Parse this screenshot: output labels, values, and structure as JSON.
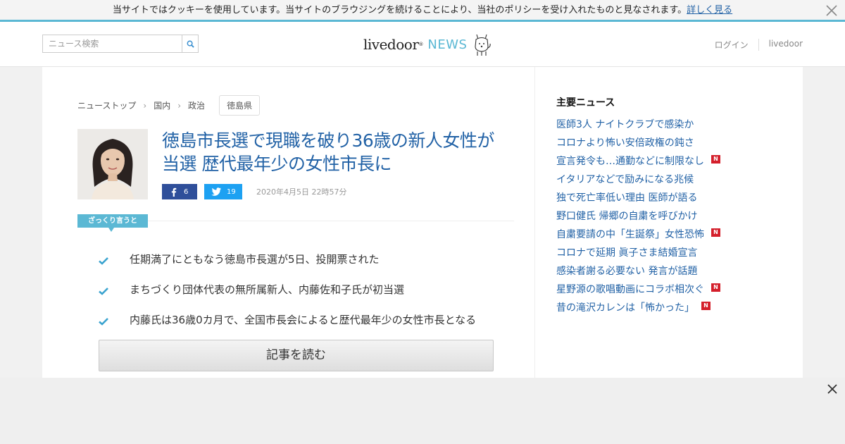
{
  "cookie": {
    "message": "当サイトではクッキーを使用しています。当サイトのブラウジングを続けることにより、当社のポリシーを受け入れたものと見なされます。",
    "link": "詳しく見る",
    "close_icon": "close-icon"
  },
  "header": {
    "search_placeholder": "ニュース検索",
    "search_icon": "search-icon",
    "logo_livedoor": "livedoor",
    "logo_news": "NEWS",
    "logo_reg": "®",
    "mascot_icon": "dog-mascot-icon",
    "login": "ログイン",
    "livedoor_link": "livedoor"
  },
  "breadcrumb": {
    "items": [
      "ニューストップ",
      "国内",
      "政治"
    ],
    "separator": "›",
    "tag": "徳島県"
  },
  "article": {
    "headline": "徳島市長選で現職を破り36歳の新人女性が当選 歴代最年少の女性市長に",
    "facebook_count": "6",
    "twitter_count": "19",
    "date": "2020年4月5日 22時57分",
    "summary_label": "ざっくり言うと",
    "points": [
      "任期満了にともなう徳島市長選が5日、投開票された",
      "まちづくり団体代表の無所属新人、内藤佐和子氏が初当選",
      "内藤氏は36歳0カ月で、全国市長会によると歴代最年少の女性市長となる"
    ],
    "read_button": "記事を読む"
  },
  "sidebar": {
    "title": "主要ニュース",
    "news": [
      {
        "title": "医師3人 ナイトクラブで感染か",
        "new": false
      },
      {
        "title": "コロナより怖い安倍政権の鈍さ",
        "new": false
      },
      {
        "title": "宣言発令も…通勤などに制限なし",
        "new": true
      },
      {
        "title": "イタリアなどで励みになる兆候",
        "new": false
      },
      {
        "title": "独で死亡率低い理由 医師が語る",
        "new": false
      },
      {
        "title": "野口健氏 帰郷の自粛を呼びかけ",
        "new": false
      },
      {
        "title": "自粛要請の中「生誕祭」女性恐怖",
        "new": true
      },
      {
        "title": "コロナで延期 眞子さま結婚宣言",
        "new": false
      },
      {
        "title": "感染者謝る必要ない 発言が話題",
        "new": false
      },
      {
        "title": "星野源の歌唱動画にコラボ相次ぐ",
        "new": true
      },
      {
        "title": "昔の滝沢カレンは「怖かった」",
        "new": true
      }
    ],
    "new_badge": "N"
  },
  "colors": {
    "accent": "#5bb8d4",
    "link": "#2262a6",
    "facebook": "#2f4f9a",
    "twitter": "#1da1f2",
    "new_badge": "#d41f2b"
  }
}
